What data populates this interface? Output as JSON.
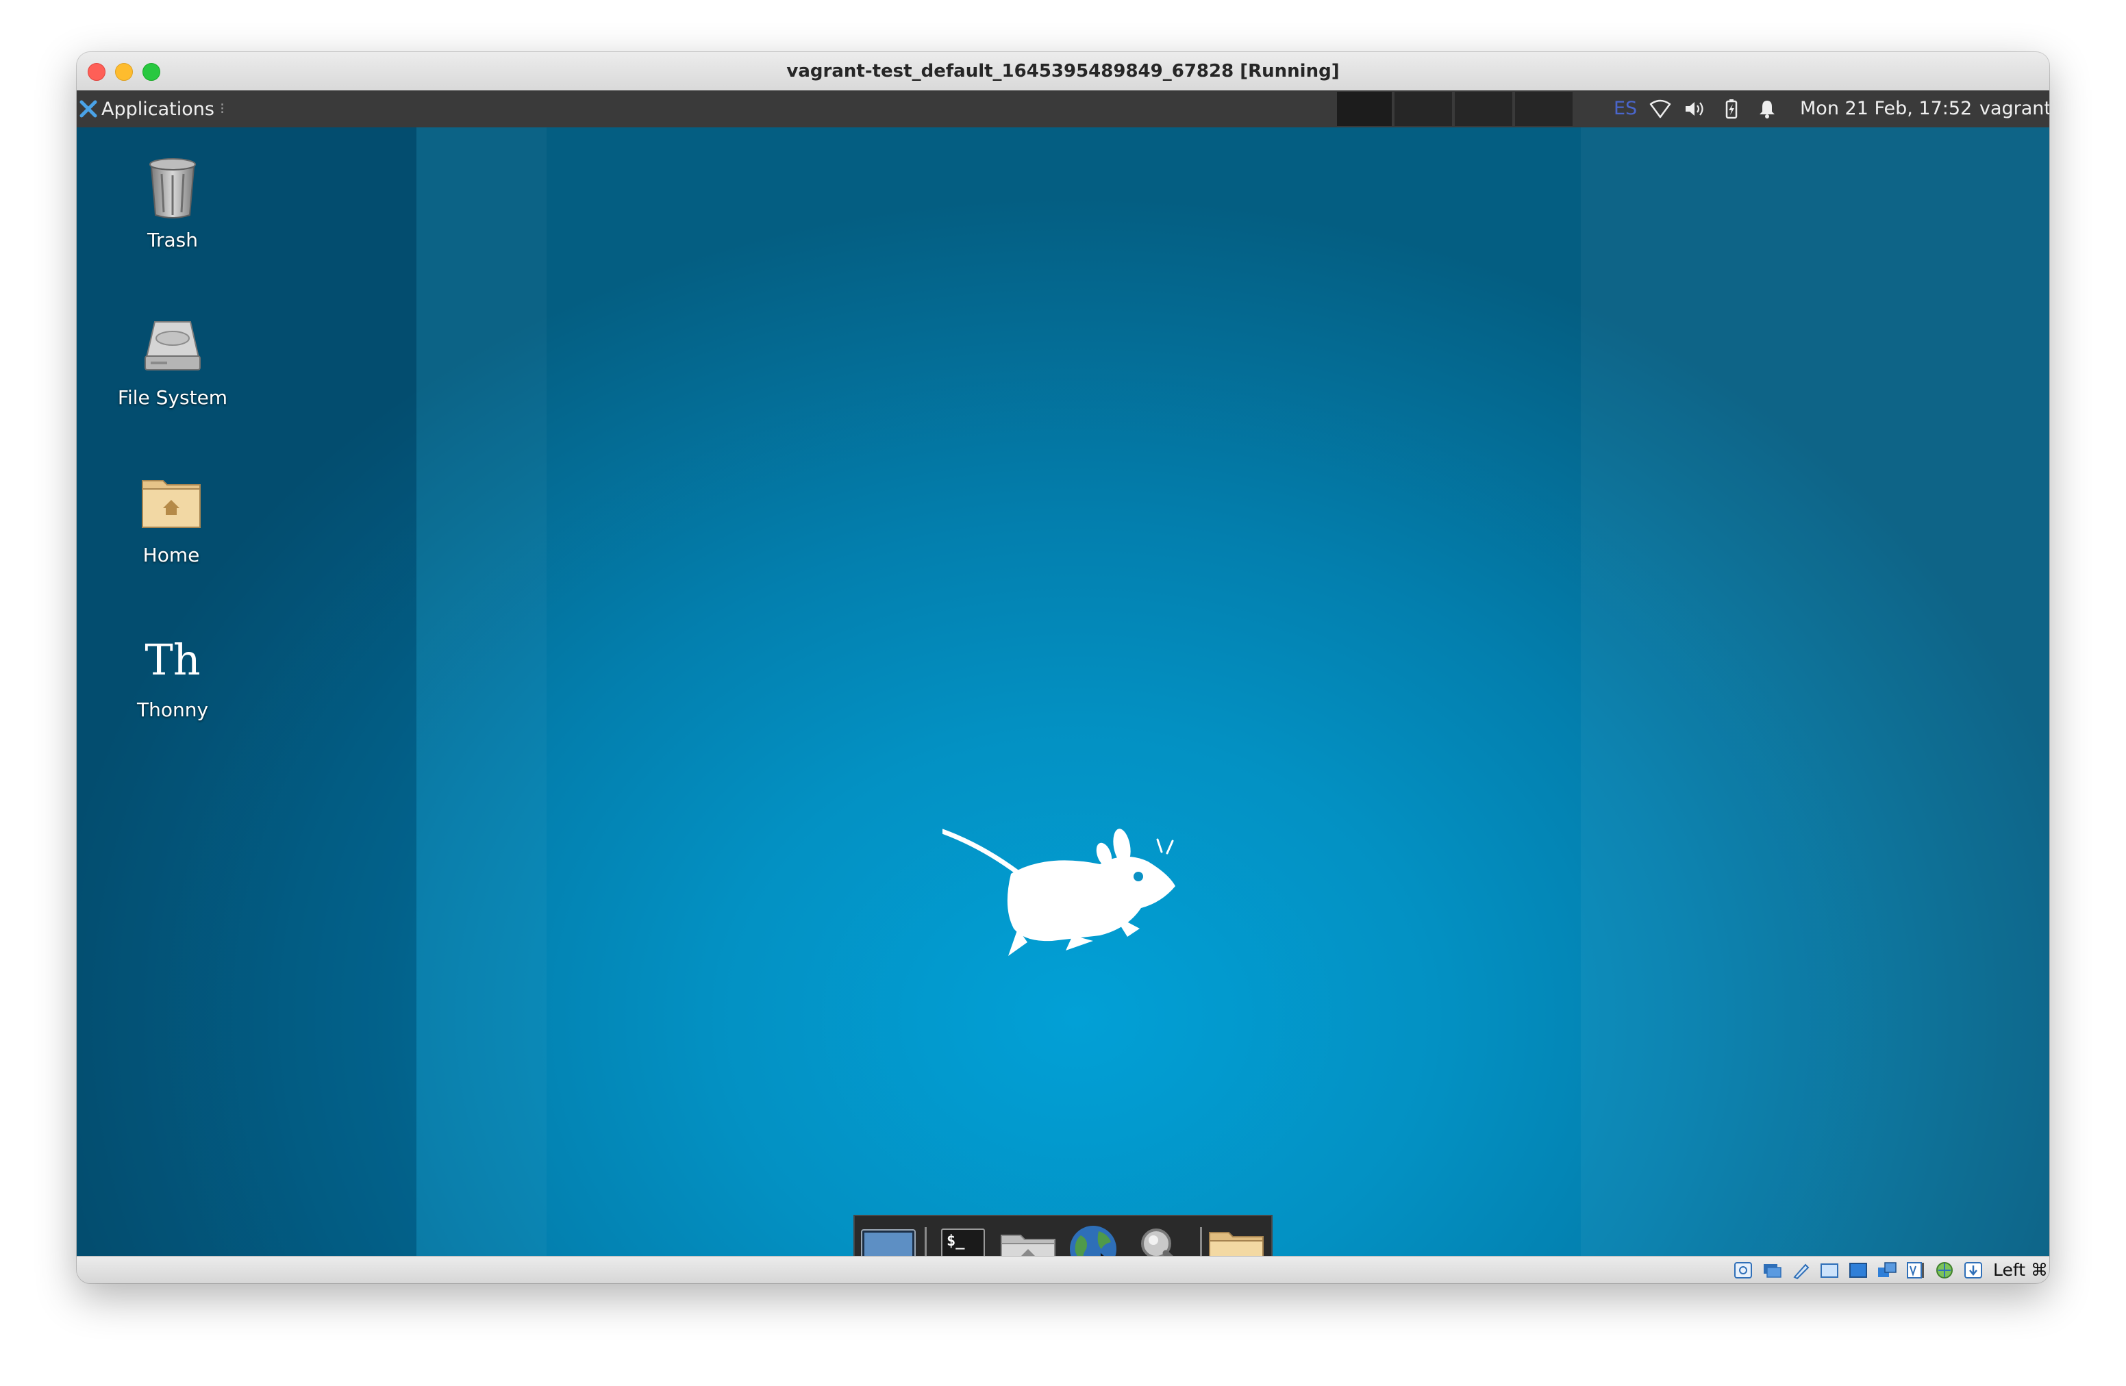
{
  "window": {
    "title": "vagrant-test_default_1645395489849_67828 [Running]"
  },
  "panel": {
    "applications_label": "Applications",
    "handle_glyph": "⁝",
    "keyboard_layout": "ES",
    "clock": "Mon 21 Feb, 17:52",
    "user": "vagrant",
    "tray_icons": [
      "keyboard-layout-indicator",
      "wifi-icon",
      "volume-icon",
      "battery-icon",
      "bell-icon"
    ]
  },
  "desktop": {
    "icons": [
      {
        "label": "Trash",
        "icon": "trash-icon"
      },
      {
        "label": "File System",
        "icon": "hard-drive-icon"
      },
      {
        "label": "Home",
        "icon": "home-folder-icon"
      },
      {
        "label": "Thonny",
        "icon": "thonny-icon"
      }
    ],
    "thonny_glyph": "Th",
    "wallpaper": "xfce-mouse-logo"
  },
  "dock": {
    "items": [
      "show-desktop",
      "terminal",
      "file-manager",
      "web-browser",
      "app-finder",
      "folder"
    ],
    "terminal_prompt": "$_"
  },
  "statusbar": {
    "host_key": "Left ⌘",
    "icons": [
      "hard-disk-icon",
      "optical-drive-icon",
      "usb-icon",
      "shared-folder-icon",
      "display-icon",
      "network-icon",
      "video-capture-icon",
      "cpu-icon",
      "mouse-integration-icon",
      "arrow-down-icon"
    ]
  },
  "colors": {
    "panel_bg": "#3a3a3a",
    "desktop_center": "#02a0d6",
    "desktop_edge": "#045e82",
    "keyboard_layout": "#4a66cc"
  }
}
